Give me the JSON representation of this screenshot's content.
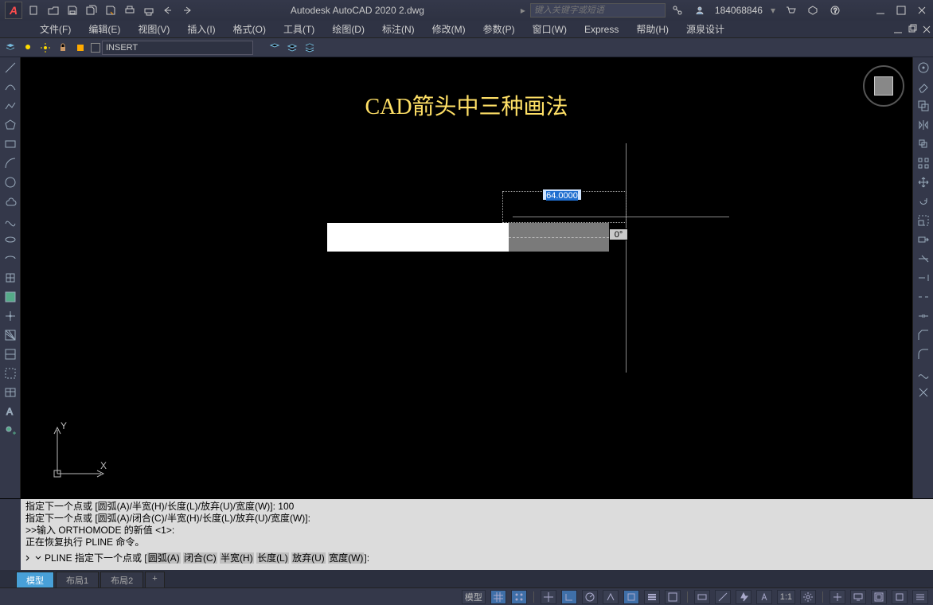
{
  "titlebar": {
    "app_title": "Autodesk AutoCAD 2020   2.dwg",
    "search_placeholder": "键入关键字或短语",
    "username": "184068846"
  },
  "menu": {
    "file": "文件(F)",
    "edit": "编辑(E)",
    "view": "视图(V)",
    "insert": "插入(I)",
    "format": "格式(O)",
    "tools": "工具(T)",
    "draw": "绘图(D)",
    "dim": "标注(N)",
    "modify": "修改(M)",
    "param": "参数(P)",
    "window": "窗口(W)",
    "express": "Express",
    "help": "帮助(H)",
    "yuanquan": "源泉设计"
  },
  "toolbar": {
    "layer_value": "INSERT"
  },
  "canvas": {
    "heading": "CAD箭头中三种画法",
    "dim_value": "64.0000",
    "angle_value": "0°",
    "ucs_x": "X",
    "ucs_y": "Y"
  },
  "cmd": {
    "l1": "指定下一个点或 [圆弧(A)/半宽(H)/长度(L)/放弃(U)/宽度(W)]: 100",
    "l2": "指定下一个点或 [圆弧(A)/闭合(C)/半宽(H)/长度(L)/放弃(U)/宽度(W)]:",
    "l3": ">>输入 ORTHOMODE 的新值 <1>:",
    "l4": "正在恢复执行 PLINE 命令。",
    "prompt_pre": "PLINE 指定下一个点或 [",
    "k_a": "圆弧(A)",
    "k_c": "闭合(C)",
    "k_h": "半宽(H)",
    "k_l": "长度(L)",
    "k_u": "放弃(U)",
    "k_w": "宽度(W)",
    "prompt_post": "]:"
  },
  "tabs": {
    "model": "模型",
    "layout1": "布局1",
    "layout2": "布局2",
    "add": "+"
  },
  "status": {
    "model": "模型",
    "scale": "1:1"
  }
}
